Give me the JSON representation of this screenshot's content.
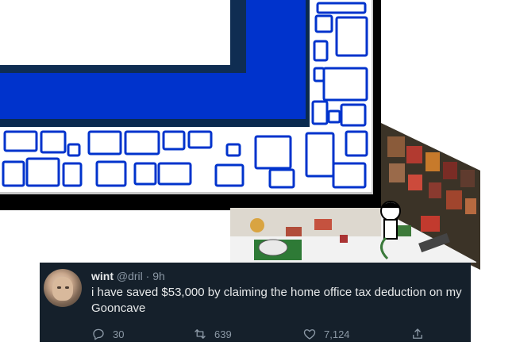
{
  "tweet": {
    "display_name": "wint",
    "handle": "@dril",
    "separator": "·",
    "time": "9h",
    "text": "i have saved $53,000 by claiming the home office tax deduction on my Gooncave",
    "actions": {
      "reply_count": "30",
      "retweet_count": "639",
      "like_count": "7,124"
    }
  },
  "icons": {
    "reply": "reply-icon",
    "retweet": "retweet-icon",
    "like": "heart-icon",
    "share": "share-icon"
  },
  "colors": {
    "tweet_bg": "#15202b",
    "frame_blue": "#0033cc",
    "frame_navy": "#0f2d52",
    "text_primary": "#e7e9ea",
    "text_secondary": "#8b98a5"
  }
}
